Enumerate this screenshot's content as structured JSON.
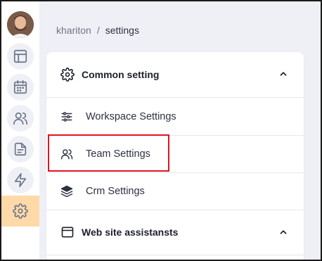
{
  "breadcrumb": {
    "user": "khariton",
    "separator": "/",
    "current": "settings"
  },
  "sidebar": {
    "items": [
      {
        "icon": "layout-icon"
      },
      {
        "icon": "calendar-icon"
      },
      {
        "icon": "users-icon"
      },
      {
        "icon": "document-icon"
      },
      {
        "icon": "lightning-icon"
      },
      {
        "icon": "gear-icon",
        "active": true
      }
    ],
    "active_color": "#ffd9a8"
  },
  "sections": [
    {
      "title": "Common setting",
      "icon": "gear-icon",
      "expanded": true,
      "items": [
        {
          "label": "Workspace Settings",
          "icon": "sliders-icon"
        },
        {
          "label": "Team Settings",
          "icon": "users-icon"
        },
        {
          "label": "Crm Settings",
          "icon": "layers-icon"
        }
      ]
    },
    {
      "title": "Web site assistansts",
      "icon": "browser-window-icon",
      "expanded": true
    }
  ],
  "colors": {
    "background": "#eef0f6",
    "highlight_border": "#e0141e"
  }
}
